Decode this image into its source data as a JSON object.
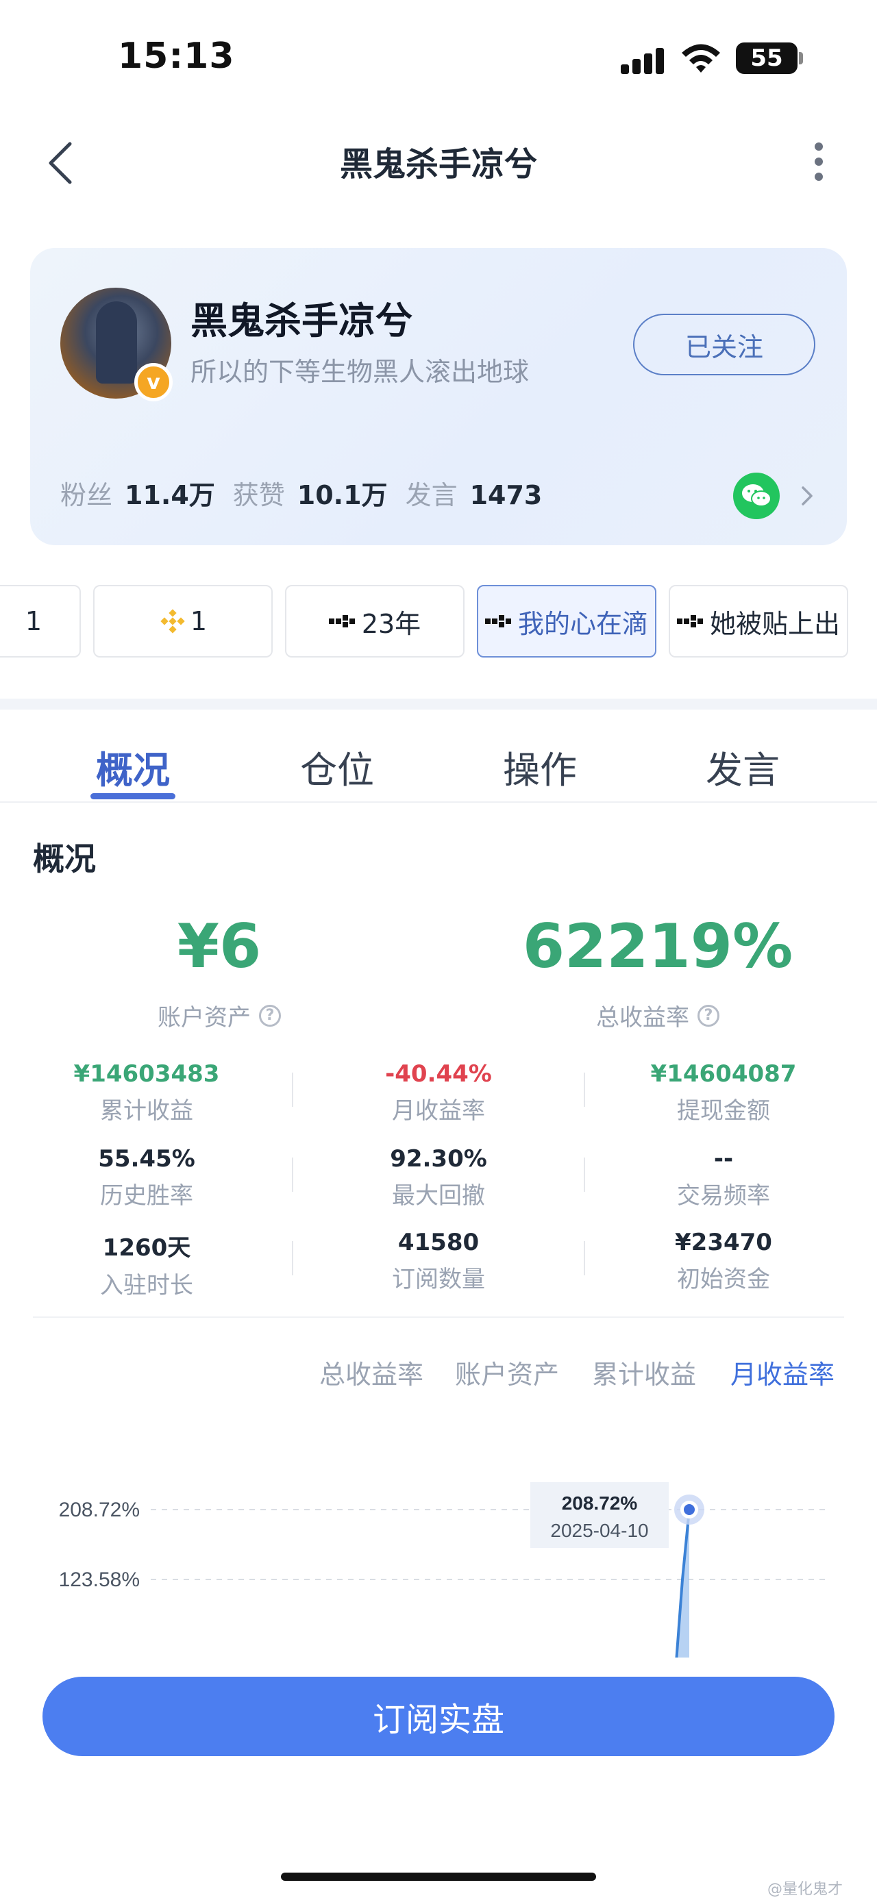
{
  "status_bar": {
    "time": "15:13",
    "battery": "55"
  },
  "nav": {
    "title": "黑鬼杀手凉兮"
  },
  "profile": {
    "name": "黑鬼杀手凉兮",
    "bio": "所以的下等生物黑人滚出地球",
    "follow_label": "已关注",
    "badge": "v",
    "stats": [
      {
        "label": "粉丝",
        "value": "11.4万"
      },
      {
        "label": "获赞",
        "value": "10.1万"
      },
      {
        "label": "发言",
        "value": "1473"
      }
    ]
  },
  "accounts": [
    {
      "label": "1",
      "icon": "none"
    },
    {
      "label": "1",
      "icon": "binance-icon"
    },
    {
      "label": "23年",
      "icon": "okx-icon"
    },
    {
      "label": "我的心在滴",
      "icon": "okx-icon",
      "active": true
    },
    {
      "label": "她被贴上出",
      "icon": "okx-icon"
    }
  ],
  "tabs": [
    "概况",
    "仓位",
    "操作",
    "发言"
  ],
  "active_tab": "概况",
  "overview": {
    "heading": "概况",
    "assets": {
      "value": "¥6",
      "label": "账户资产"
    },
    "total_return": {
      "value": "62219%",
      "label": "总收益率"
    },
    "metrics": [
      {
        "value": "¥14603483",
        "label": "累计收益",
        "tone": "pos"
      },
      {
        "value": "-40.44%",
        "label": "月收益率",
        "tone": "neg"
      },
      {
        "value": "¥14604087",
        "label": "提现金额",
        "tone": "pos"
      },
      {
        "value": "55.45%",
        "label": "历史胜率",
        "tone": "neutral"
      },
      {
        "value": "92.30%",
        "label": "最大回撤",
        "tone": "neutral"
      },
      {
        "value": "--",
        "label": "交易频率",
        "tone": "neutral"
      },
      {
        "value": "1260天",
        "label": "入驻时长",
        "tone": "neutral"
      },
      {
        "value": "41580",
        "label": "订阅数量",
        "tone": "neutral"
      },
      {
        "value": "¥23470",
        "label": "初始资金",
        "tone": "neutral"
      }
    ]
  },
  "chart_tabs": [
    "总收益率",
    "账户资产",
    "累计收益",
    "月收益率"
  ],
  "active_chart_tab": "月收益率",
  "chart_data": {
    "type": "line",
    "y_ticks": [
      "208.72%",
      "123.58%"
    ],
    "y_tick_values": [
      208.72,
      123.58
    ],
    "tooltip": {
      "value": "208.72%",
      "date": "2025-04-10"
    },
    "points": [
      {
        "x": "2025-04-08",
        "y": 0
      },
      {
        "x": "2025-04-09",
        "y": 123.58
      },
      {
        "x": "2025-04-10",
        "y": 208.72
      }
    ],
    "colors": {
      "line": "#3b82d6",
      "fill": "#9fc3ef",
      "grid": "#d9dde3",
      "marker": "#3f6fdc"
    }
  },
  "cta_label": "订阅实盘",
  "watermark": "@量化鬼才"
}
